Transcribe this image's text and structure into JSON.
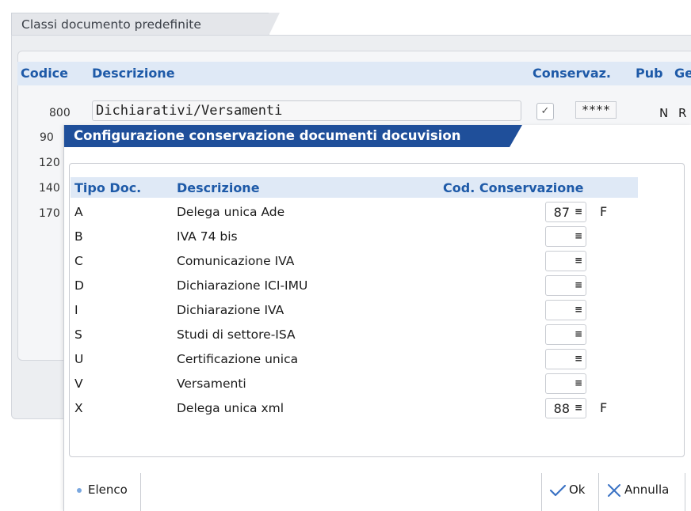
{
  "background": {
    "tab_title": "Classi documento predefinite",
    "columns": {
      "codice": "Codice",
      "descrizione": "Descrizione",
      "conservaz": "Conservaz.",
      "pub": "Pub",
      "ge": "Ge"
    },
    "row_800": {
      "code": "800",
      "description": "Dichiarativi/Versamenti",
      "stars": "****",
      "pub": "N",
      "ge": "R"
    },
    "partial_codes": [
      "90",
      "120",
      "140",
      "170"
    ]
  },
  "dialog": {
    "title": "Configurazione conservazione documenti docuvision",
    "columns": {
      "tipo": "Tipo Doc.",
      "descrizione": "Descrizione",
      "cod": "Cod. Conservazione"
    },
    "rows": [
      {
        "tipo": "A",
        "descrizione": "Delega unica Ade",
        "cod": "87",
        "flag": "F"
      },
      {
        "tipo": "B",
        "descrizione": "IVA 74 bis",
        "cod": "",
        "flag": ""
      },
      {
        "tipo": "C",
        "descrizione": "Comunicazione IVA",
        "cod": "",
        "flag": ""
      },
      {
        "tipo": "D",
        "descrizione": "Dichiarazione ICI-IMU",
        "cod": "",
        "flag": ""
      },
      {
        "tipo": "I",
        "descrizione": "Dichiarazione IVA",
        "cod": "",
        "flag": ""
      },
      {
        "tipo": "S",
        "descrizione": "Studi di settore-ISA",
        "cod": "",
        "flag": ""
      },
      {
        "tipo": "U",
        "descrizione": "Certificazione unica",
        "cod": "",
        "flag": ""
      },
      {
        "tipo": "V",
        "descrizione": "Versamenti",
        "cod": "",
        "flag": ""
      },
      {
        "tipo": "X",
        "descrizione": "Delega unica xml",
        "cod": "88",
        "flag": "F"
      }
    ],
    "footer": {
      "elenco": "Elenco",
      "ok": "Ok",
      "annulla": "Annulla"
    }
  },
  "icons": {
    "menu": "≡",
    "check": "✓"
  }
}
